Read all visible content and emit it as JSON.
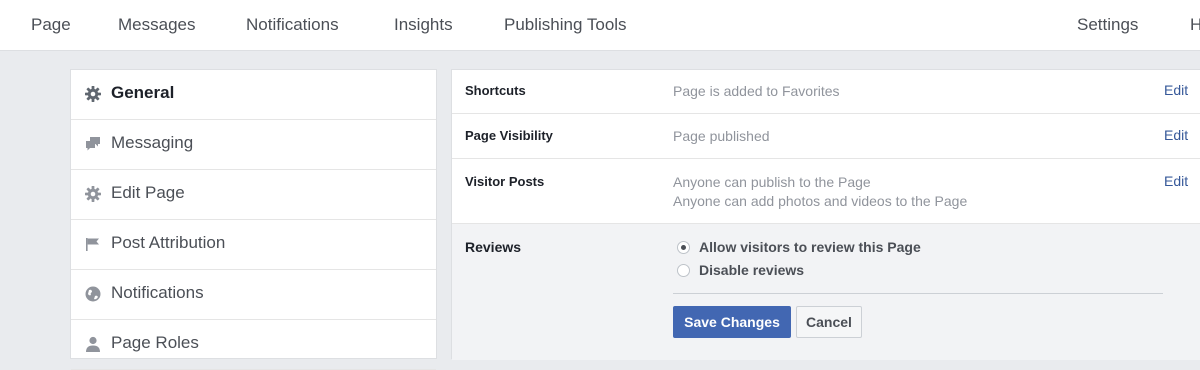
{
  "topnav": {
    "items": [
      "Page",
      "Messages",
      "Notifications",
      "Insights",
      "Publishing Tools"
    ],
    "settings": "Settings",
    "help_partial": "H"
  },
  "sidebar": {
    "items": [
      {
        "label": "General",
        "icon": "gear-icon",
        "active": true
      },
      {
        "label": "Messaging",
        "icon": "chat-bubbles-icon"
      },
      {
        "label": "Edit Page",
        "icon": "gear-icon"
      },
      {
        "label": "Post Attribution",
        "icon": "flag-icon"
      },
      {
        "label": "Notifications",
        "icon": "globe-icon"
      },
      {
        "label": "Page Roles",
        "icon": "person-icon"
      }
    ]
  },
  "settings": {
    "rows": [
      {
        "name": "Shortcuts",
        "value": "Page is added to Favorites",
        "edit": "Edit"
      },
      {
        "name": "Page Visibility",
        "value": "Page published",
        "edit": "Edit"
      },
      {
        "name": "Visitor Posts",
        "value_lines": [
          "Anyone can publish to the Page",
          "Anyone can add photos and videos to the Page"
        ],
        "edit": "Edit"
      }
    ],
    "reviews": {
      "name": "Reviews",
      "options": [
        {
          "label": "Allow visitors to review this Page",
          "checked": true
        },
        {
          "label": "Disable reviews",
          "checked": false
        }
      ],
      "save_label": "Save Changes",
      "cancel_label": "Cancel"
    }
  },
  "colors": {
    "accent": "#4267b2",
    "link": "#365899",
    "background": "#e9ebee"
  }
}
